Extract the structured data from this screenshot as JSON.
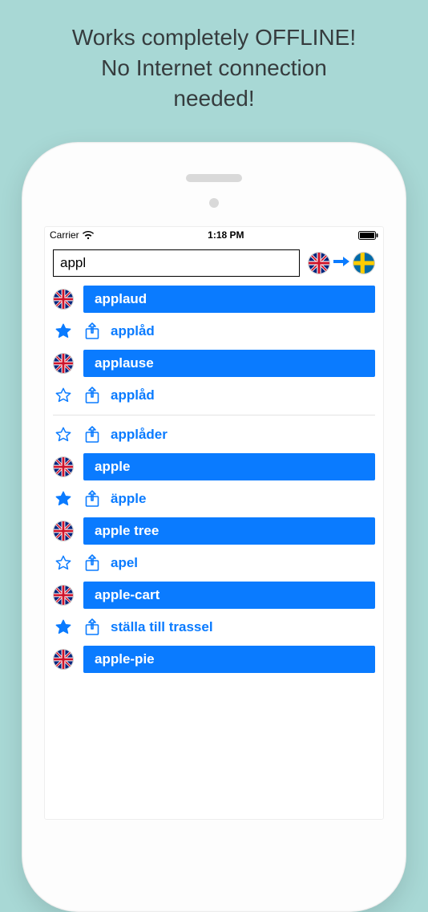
{
  "promo": {
    "line1": "Works completely OFFLINE!",
    "line2": "No Internet connection",
    "line3": "needed!"
  },
  "status": {
    "carrier": "Carrier",
    "time": "1:18 PM"
  },
  "search": {
    "value": "appl",
    "placeholder": ""
  },
  "lang": {
    "from": "uk",
    "to": "se"
  },
  "rows": [
    {
      "kind": "header",
      "flag": "uk",
      "word": "applaud"
    },
    {
      "kind": "trans",
      "fav": "filled",
      "share": true,
      "word": "applåd"
    },
    {
      "kind": "header",
      "flag": "uk",
      "word": "applause"
    },
    {
      "kind": "trans",
      "fav": "outline",
      "share": true,
      "word": "applåd"
    },
    {
      "kind": "divider"
    },
    {
      "kind": "trans",
      "fav": "outline",
      "share": true,
      "word": "applåder"
    },
    {
      "kind": "header",
      "flag": "uk",
      "word": "apple"
    },
    {
      "kind": "trans",
      "fav": "filled",
      "share": true,
      "word": "äpple"
    },
    {
      "kind": "header",
      "flag": "uk",
      "word": "apple tree"
    },
    {
      "kind": "trans",
      "fav": "outline",
      "share": true,
      "word": "apel"
    },
    {
      "kind": "header",
      "flag": "uk",
      "word": "apple-cart"
    },
    {
      "kind": "trans",
      "fav": "filled",
      "share": true,
      "word": "ställa till trassel"
    },
    {
      "kind": "header",
      "flag": "uk",
      "word": "apple-pie"
    }
  ]
}
